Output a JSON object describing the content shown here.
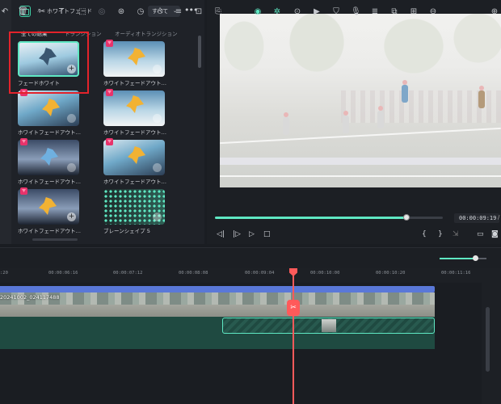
{
  "effects_panel": {
    "search": {
      "value": "ホワイトフェード",
      "placeholder": ""
    },
    "filter_label": "すべて",
    "categories": [
      "全ての結果",
      "トランジション",
      "オーディオトランジション"
    ],
    "items": [
      {
        "label": "フェードホワイト",
        "badge": "plus-icon",
        "premium": false
      },
      {
        "label": "ホワイトフェードアウトトランジ…",
        "badge": "download-icon",
        "premium": true
      },
      {
        "label": "ホワイトフェードアウトトラン…",
        "badge": "download-icon",
        "premium": true
      },
      {
        "label": "ホワイトフェードアウトトランジ…",
        "badge": "download-icon",
        "premium": true
      },
      {
        "label": "ホワイトフェードアウトトラン…",
        "badge": "download-icon",
        "premium": true
      },
      {
        "label": "ホワイトフェードアウトトランジ…",
        "badge": "download-icon",
        "premium": true
      },
      {
        "label": "ホワイトフェードアウトトラン…",
        "badge": "plus-icon",
        "premium": true
      },
      {
        "label": "ブレーンシェイプ 5",
        "badge": "download-icon",
        "premium": false
      }
    ]
  },
  "preview": {
    "timecode": "00:00:09:19",
    "playback_fraction": 0.84
  },
  "timeline": {
    "ruler_labels": [
      ":20",
      "00:00:06:16",
      "00:00:07:12",
      "00:00:08:08",
      "00:00:09:04",
      "00:00:10:00",
      "00:00:10:20",
      "00:00:11:16"
    ],
    "clip_label": "20241002_024117488",
    "zoom_fraction": 0.75
  },
  "colors": {
    "accent": "#5fe8c3",
    "playhead": "#ff5a5a",
    "highlight": "#e3232b",
    "clip_blue": "#5a78d8",
    "premium": "#e8336b"
  }
}
